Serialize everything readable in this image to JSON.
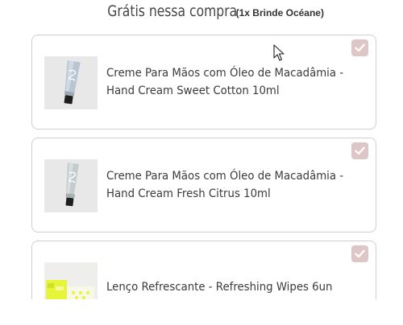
{
  "header": {
    "title": "Grátis nessa compra",
    "subtitle": "(1x Brinde Océane)"
  },
  "items": [
    {
      "name": "Creme Para Mãos com Óleo de Macadâmia - Hand Cream Sweet Cotton 10ml",
      "checked": true,
      "image_icon": "hand-cream-tube"
    },
    {
      "name": "Creme Para Mãos com Óleo de Macadâmia - Hand Cream Fresh Citrus 10ml",
      "checked": true,
      "image_icon": "hand-cream-tube"
    },
    {
      "name": "Lenço Refrescante - Refreshing Wipes 6un",
      "checked": true,
      "image_icon": "wipes-pack"
    }
  ],
  "colors": {
    "checkbox_bg": "#dfc6c6",
    "card_border": "#cfcfcf",
    "wipes_accent": "#e6f53a"
  }
}
